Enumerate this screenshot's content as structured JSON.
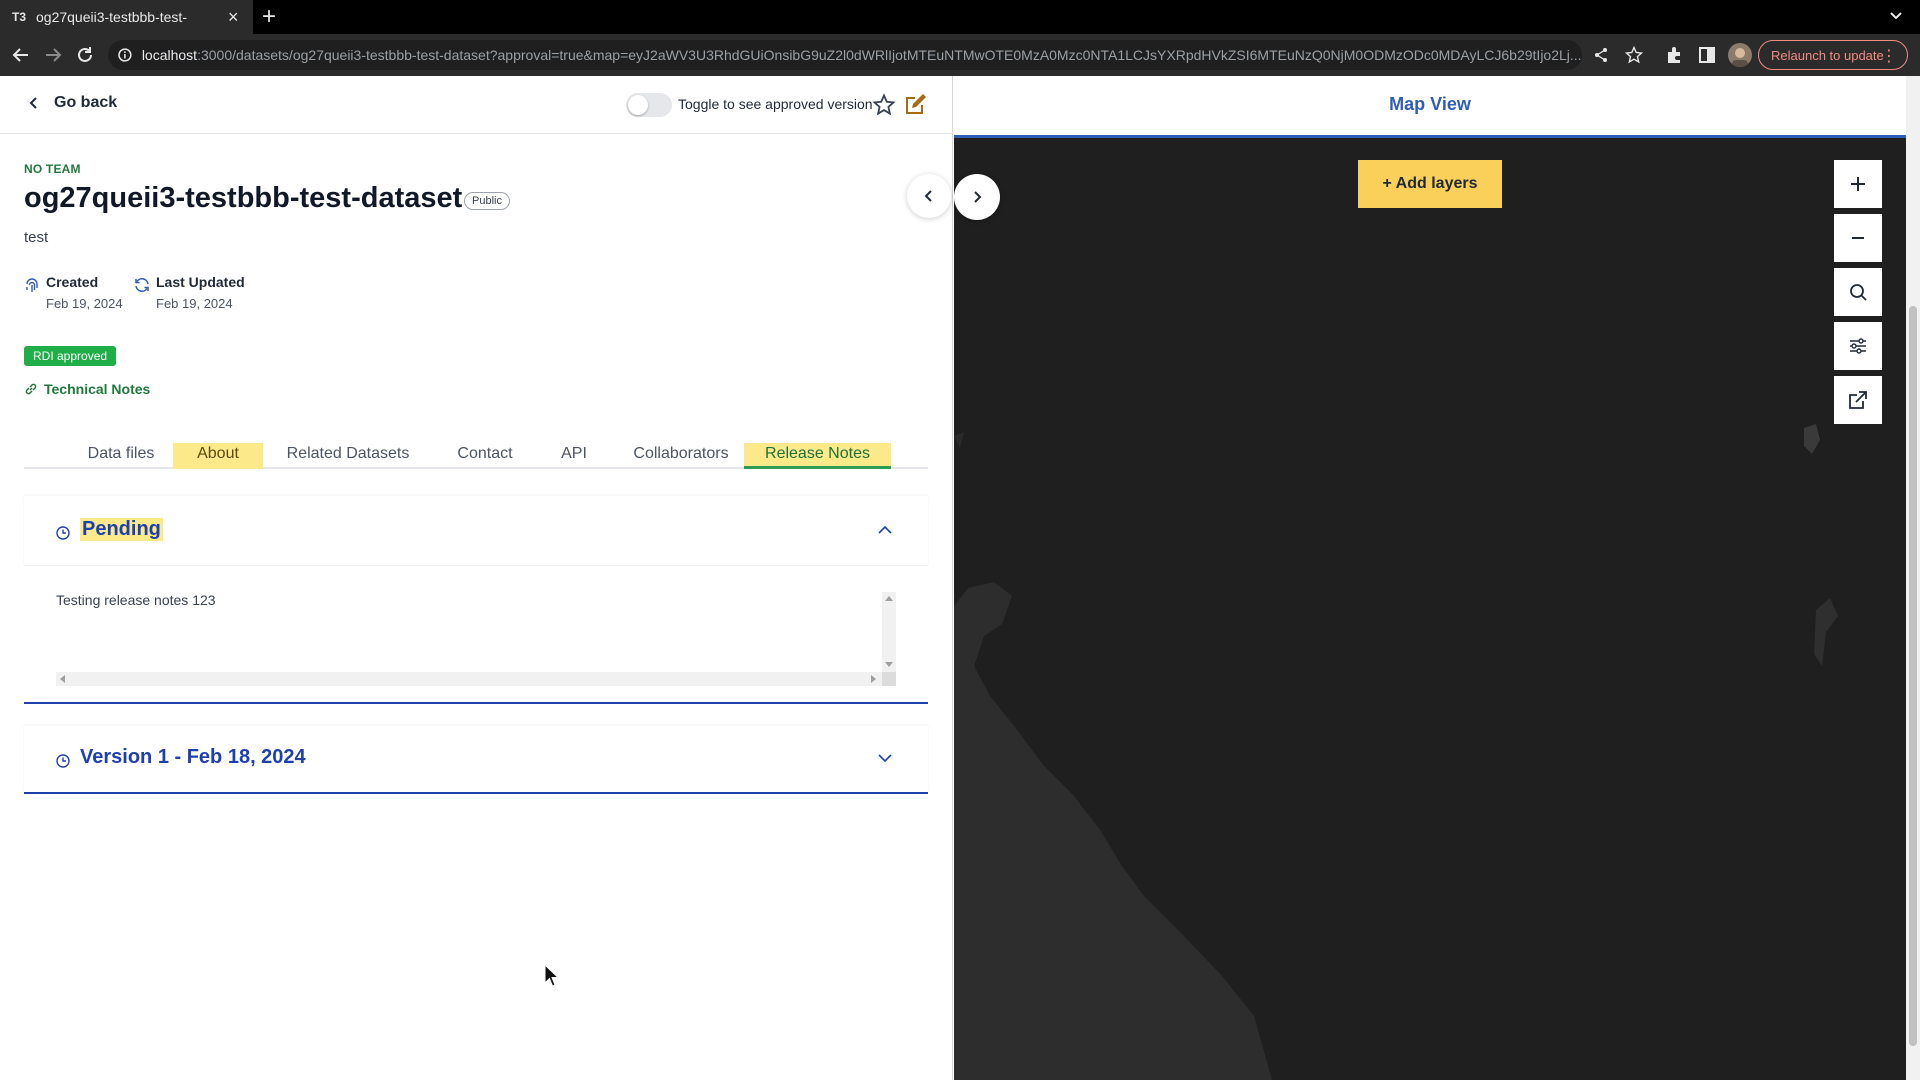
{
  "browser": {
    "tab_favicon": "T3",
    "tab_title": "og27queii3-testbbb-test-",
    "url_host": "localhost",
    "url_rest": ":3000/datasets/og27queii3-testbbb-test-dataset?approval=true&map=eyJ2aWV3U3RhdGUiOnsibG9uZ2l0dWRlIjotMTEuNTMwOTE0MzA0Mzc0NTA1LCJsYXRpdHVkZSI6MTEuNzQ0NjM0ODMzODc0MDAyLCJ6b29tIjo2Lj...",
    "relaunch_label": "Relaunch to update"
  },
  "dataset": {
    "go_back": "Go back",
    "toggle_label": "Toggle to see approved version",
    "team": "NO TEAM",
    "title": "og27queii3-testbbb-test-dataset",
    "visibility": "Public",
    "description": "test",
    "created_label": "Created",
    "created_date": "Feb 19, 2024",
    "updated_label": "Last Updated",
    "updated_date": "Feb 19, 2024",
    "rdi_badge": "RDI approved",
    "technical_notes": "Technical Notes"
  },
  "tabs": [
    "Data files",
    "About",
    "Related Datasets",
    "Contact",
    "API",
    "Collaborators",
    "Release Notes"
  ],
  "release_notes": {
    "pending_title": "Pending",
    "pending_text": "Testing release notes 123",
    "version_title": "Version 1 - Feb 18, 2024"
  },
  "map": {
    "title": "Map View",
    "add_layers": "+ Add layers",
    "controls": [
      "plus-icon",
      "minus-icon",
      "search-icon",
      "sliders-icon",
      "external-link-icon"
    ]
  },
  "colors": {
    "accent_green": "#1f7a3c",
    "badge_green": "#1fae47",
    "highlight_yellow": "#fbe98a",
    "section_blue": "#1e40af",
    "map_bg": "#1f1f1f",
    "add_layers_yellow": "#fbd05a"
  }
}
